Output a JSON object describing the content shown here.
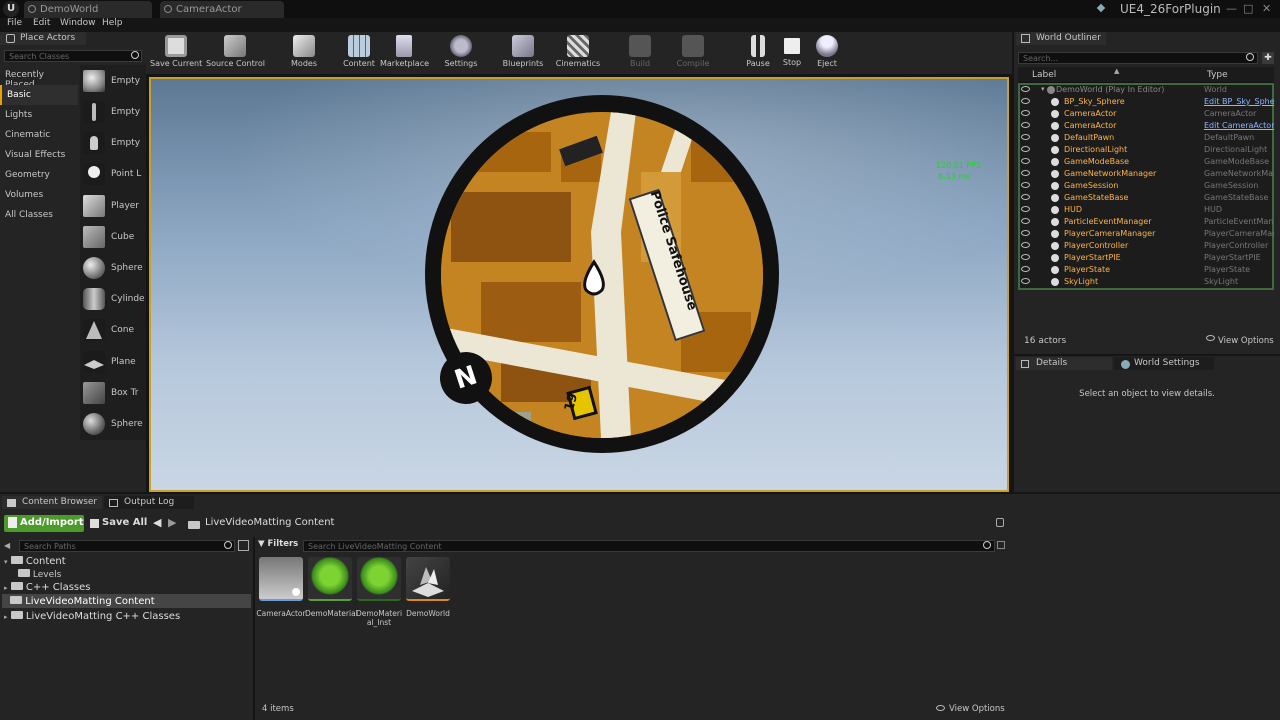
{
  "title_bar": {
    "tabs": [
      "DemoWorld",
      "CameraActor"
    ],
    "project_name": "UE4_26ForPlugin"
  },
  "menu": [
    "File",
    "Edit",
    "Window",
    "Help"
  ],
  "place_actors": {
    "tab_label": "Place Actors",
    "search_placeholder": "Search Classes",
    "categories": [
      "Recently Placed",
      "Basic",
      "Lights",
      "Cinematic",
      "Visual Effects",
      "Geometry",
      "Volumes",
      "All Classes"
    ],
    "selected_category": "Basic",
    "items": [
      "Empty",
      "Empty",
      "Empty",
      "Point L",
      "Player",
      "Cube",
      "Sphere",
      "Cylinde",
      "Cone",
      "Plane",
      "Box Tr",
      "Sphere"
    ]
  },
  "toolbar": {
    "buttons": [
      "Save Current",
      "Source Control",
      "Modes",
      "Content",
      "Marketplace",
      "Settings",
      "Blueprints",
      "Cinematics",
      "Build",
      "Compile",
      "Pause",
      "Stop",
      "Eject"
    ]
  },
  "viewport": {
    "fps": "120.01 FPS",
    "ms": "8.33 ms",
    "map_label": "Police Safehouse",
    "compass": "N",
    "badge": "19"
  },
  "world_outliner": {
    "tab_label": "World Outliner",
    "search_placeholder": "Search...",
    "col_label": "Label",
    "col_type": "Type",
    "root": {
      "label": "DemoWorld (Play In Editor)",
      "type": "World"
    },
    "rows": [
      {
        "label": "BP_Sky_Sphere",
        "type": "Edit BP_Sky_Sphe",
        "link": true
      },
      {
        "label": "CameraActor",
        "type": "CameraActor",
        "link": false
      },
      {
        "label": "CameraActor",
        "type": "Edit CameraActor",
        "link": true
      },
      {
        "label": "DefaultPawn",
        "type": "DefaultPawn",
        "link": false
      },
      {
        "label": "DirectionalLight",
        "type": "DirectionalLight",
        "link": false
      },
      {
        "label": "GameModeBase",
        "type": "GameModeBase",
        "link": false
      },
      {
        "label": "GameNetworkManager",
        "type": "GameNetworkMana",
        "link": false
      },
      {
        "label": "GameSession",
        "type": "GameSession",
        "link": false
      },
      {
        "label": "GameStateBase",
        "type": "GameStateBase",
        "link": false
      },
      {
        "label": "HUD",
        "type": "HUD",
        "link": false
      },
      {
        "label": "ParticleEventManager",
        "type": "ParticleEventMana",
        "link": false
      },
      {
        "label": "PlayerCameraManager",
        "type": "PlayerCameraMana",
        "link": false
      },
      {
        "label": "PlayerController",
        "type": "PlayerController",
        "link": false
      },
      {
        "label": "PlayerStartPIE",
        "type": "PlayerStartPIE",
        "link": false
      },
      {
        "label": "PlayerState",
        "type": "PlayerState",
        "link": false
      },
      {
        "label": "SkyLight",
        "type": "SkyLight",
        "link": false
      }
    ],
    "actor_count": "16 actors",
    "view_options": "View Options"
  },
  "details": {
    "tab_details": "Details",
    "tab_world_settings": "World Settings",
    "empty_message": "Select an object to view details."
  },
  "content_browser": {
    "tab_content": "Content Browser",
    "tab_output": "Output Log",
    "add_import": "Add/Import",
    "save_all": "Save All",
    "breadcrumb": "LiveVideoMatting Content",
    "search_paths_placeholder": "Search Paths",
    "filters": "Filters",
    "search_assets_placeholder": "Search LiveVideoMatting Content",
    "tree": [
      "Content",
      "Levels",
      "C++ Classes",
      "LiveVideoMatting Content",
      "LiveVideoMatting C++ Classes"
    ],
    "assets": [
      "CameraActor",
      "DemoMaterial",
      "DemoMaterial_Inst",
      "DemoWorld"
    ],
    "item_count": "4 items",
    "view_options": "View Options"
  }
}
